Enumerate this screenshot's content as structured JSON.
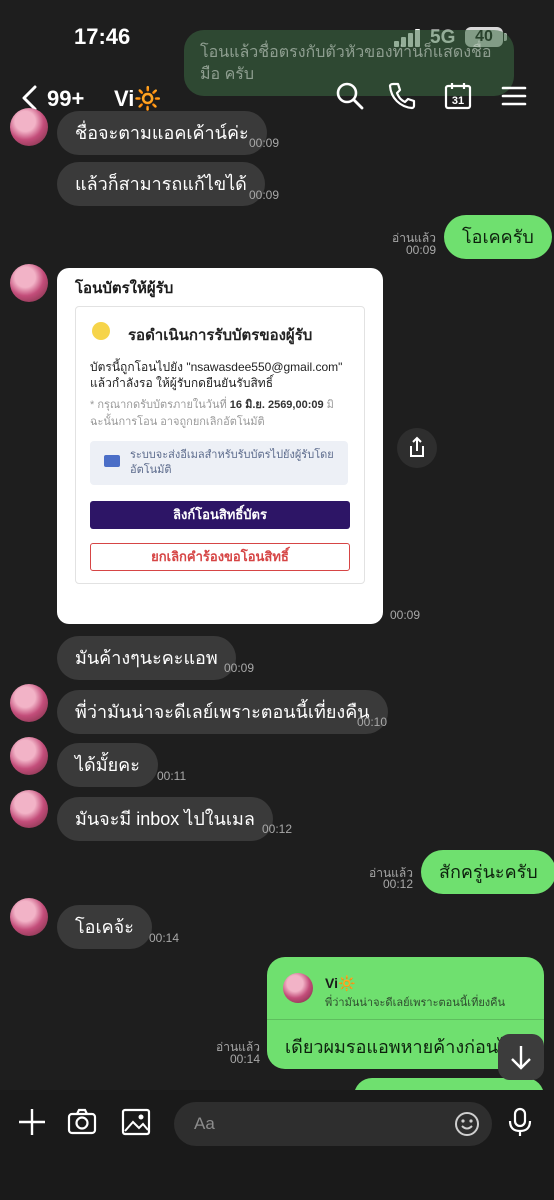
{
  "status": {
    "time": "17:46",
    "network": "5G",
    "battery": "40"
  },
  "header": {
    "unread": "99+",
    "title": "Vi🔆"
  },
  "ghost": {
    "text": "โอนแล้วชื่อตรงกับตัวหัวของท่านก็แสดงชื่อมือ ครับ"
  },
  "messages": [
    {
      "text": "ชื่อจะตามแอคเค้าน์ค่ะ",
      "time": "00:09"
    },
    {
      "text": "แล้วก็สามารถแก้ไขได้",
      "time": "00:09"
    },
    {
      "text": "โอเคครับ",
      "time": "00:09",
      "read": "อ่านแล้ว"
    },
    {
      "time": "00:09"
    },
    {
      "text": "มันค้างๆนะคะแอพ",
      "time": "00:09"
    },
    {
      "text": "พี่ว่ามันน่าจะดีเลย์เพราะตอนนี้เที่ยงคืน",
      "time": "00:10"
    },
    {
      "text": "ได้มั้ยคะ",
      "time": "00:11"
    },
    {
      "text": "มันจะมี inbox ไปในเมล",
      "time": "00:12"
    },
    {
      "text": "สักครู่นะครับ",
      "time": "00:12",
      "read": "อ่านแล้ว"
    },
    {
      "text": "โอเคจ้ะ",
      "time": "00:14"
    }
  ],
  "card": {
    "title": "โอนบัตรให้ผู้รับ",
    "status_title": "รอดำเนินการรับบัตรของผู้รับ",
    "desc": "บัตรนี้ถูกโอนไปยัง \"nsawasdee550@gmail.com\" แล้วกำลังรอ ให้ผู้รับกดยืนยันรับสิทธิ์",
    "note_prefix": "* กรุณากดรับบัตรภายในวันที่ ",
    "note_date": "16 มิ.ย. 2569,00:09",
    "note_suffix": " มิฉะนั้นการโอน อาจถูกยกเลิกอัตโนมัติ",
    "mail_note": "ระบบจะส่งอีเมลสำหรับรับบัตรไปยังผู้รับโดยอัตโนมัติ",
    "primary_button": "ลิงก์โอนสิทธิ์บัตร",
    "cancel_button": "ยกเลิกคำร้องขอโอนสิทธิ์"
  },
  "reply": {
    "quoted_name": "Vi🔆",
    "quoted_text": "พี่ว่ามันน่าจะดีเลย์เพราะตอนนี้เที่ยงคืน",
    "text": "เดียวผมรอแอพหายค้างก่อนได้",
    "time": "00:14",
    "read": "อ่านแล้ว"
  },
  "input": {
    "placeholder": "Aa"
  },
  "colors": {
    "background": "#1e1e1e",
    "incoming": "#3a3a3a",
    "outgoing": "#6fe06f",
    "card_button": "#2d1566"
  }
}
